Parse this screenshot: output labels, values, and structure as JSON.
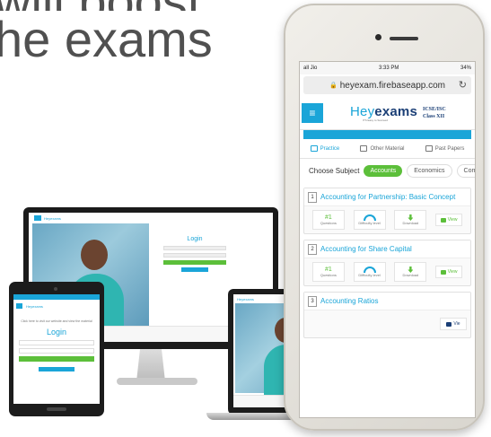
{
  "headline": {
    "line1": "will boost",
    "line2": "he exams"
  },
  "phone": {
    "status": {
      "signal": "all Jio",
      "time": "3:33 PM",
      "battery": "34%"
    },
    "url": "heyexam.firebaseapp.com",
    "brand": {
      "prefix": "Hey",
      "suffix": "exams",
      "tagline": "ITS Easy to Succeed",
      "board_line1": "ICSE/ISC",
      "board_line2": "Class XII"
    },
    "tabs": [
      {
        "label": "Practice"
      },
      {
        "label": "Other Material"
      },
      {
        "label": "Past Papers"
      }
    ],
    "subject_label": "Choose Subject",
    "subjects": [
      "Accounts",
      "Economics",
      "Com"
    ],
    "topics": [
      {
        "num": "1",
        "title": "Accounting for Partnership: Basic Concept",
        "questions_value": "#1",
        "questions_label": "Questions",
        "difficulty_label": "Difficulty level",
        "download_label": "Download",
        "view_label": "View"
      },
      {
        "num": "2",
        "title": "Accounting for Share Capital",
        "questions_value": "#1",
        "questions_label": "Questions",
        "difficulty_label": "Difficulty level",
        "download_label": "Download",
        "view_label": "View"
      },
      {
        "num": "3",
        "title": "Accounting Ratios",
        "view_label": "Vie"
      }
    ]
  },
  "monitor": {
    "logo": "Heyexams",
    "login_label": "Login"
  },
  "tablet": {
    "logo": "Heyexams",
    "welcome": "Click here to visit our website and view the material",
    "login_label": "Login"
  },
  "laptop": {
    "logo": "Heyexams"
  },
  "colors": {
    "brand_blue": "#1aa5d8",
    "brand_green": "#5cbf3a",
    "brand_navy": "#1b3f76"
  }
}
